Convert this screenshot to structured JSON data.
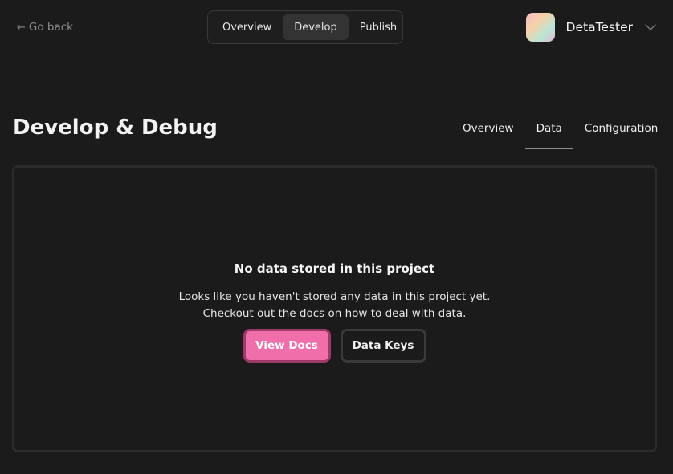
{
  "topbar": {
    "go_back_label": "Go back",
    "nav": [
      "Overview",
      "Develop",
      "Publish"
    ],
    "active_nav": "Develop",
    "user": {
      "name": "DetaTester"
    }
  },
  "page": {
    "title": "Develop & Debug",
    "tabs": [
      "Overview",
      "Data",
      "Configuration"
    ],
    "active_tab": "Data"
  },
  "empty_state": {
    "title": "No data stored in this project",
    "line1": "Looks like you haven't stored any data in this project yet.",
    "line2": "Checkout out the docs on how to deal with data.",
    "primary_button": "View Docs",
    "secondary_button": "Data Keys"
  },
  "colors": {
    "background": "#1b1b1b",
    "accent": "#f06faa",
    "accent_border": "#9e3a6a",
    "panel_border": "#2c2c2c"
  },
  "icons": {
    "back": "arrow-left-icon",
    "user_menu": "chevron-down-icon"
  }
}
